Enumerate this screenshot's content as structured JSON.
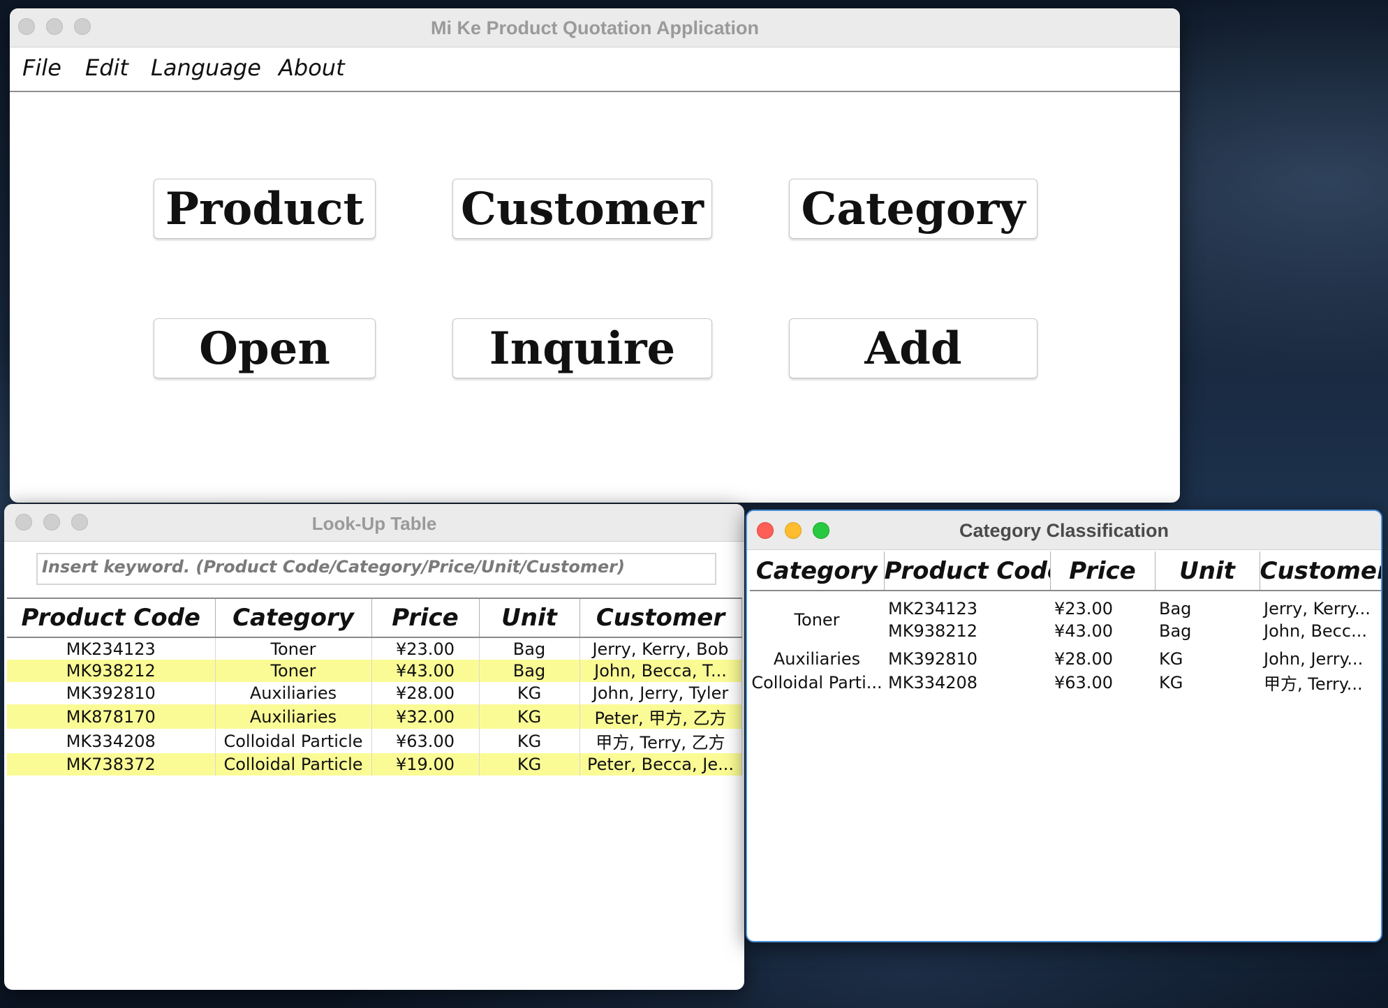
{
  "main": {
    "title": "Mi Ke Product Quotation Application",
    "menu": [
      "File",
      "Edit",
      "Language",
      "About"
    ],
    "buttons": [
      "Product",
      "Customer",
      "Category",
      "Open",
      "Inquire",
      "Add"
    ]
  },
  "lookup": {
    "title": "Look-Up Table",
    "search_placeholder": "Insert keyword. (Product Code/Category/Price/Unit/Customer)",
    "headers": [
      "Product Code",
      "Category",
      "Price",
      "Unit",
      "Customer"
    ],
    "rows": [
      [
        "MK234123",
        "Toner",
        "¥23.00",
        "Bag",
        "Jerry,  Kerry,  Bob"
      ],
      [
        "MK938212",
        "Toner",
        "¥43.00",
        "Bag",
        "John,   Becca,   T..."
      ],
      [
        "MK392810",
        "Auxiliaries",
        "¥28.00",
        "KG",
        "John,   Jerry,   Tyler"
      ],
      [
        "MK878170",
        "Auxiliaries",
        "¥32.00",
        "KG",
        "Peter, 甲方, 乙方"
      ],
      [
        "MK334208",
        "Colloidal Particle",
        "¥63.00",
        "KG",
        "甲方, Terry, 乙方"
      ],
      [
        "MK738372",
        "Colloidal Particle",
        "¥19.00",
        "KG",
        "Peter,  Becca,  Je..."
      ]
    ]
  },
  "category": {
    "title": "Category Classification",
    "headers": [
      "Category",
      "Product Code",
      "Price",
      "Unit",
      "Customer"
    ],
    "groups": [
      {
        "name": "Toner",
        "rows": [
          [
            "MK234123",
            "¥23.00",
            "Bag",
            "Jerry,  Kerry..."
          ],
          [
            "MK938212",
            "¥43.00",
            "Bag",
            "John,    Becc..."
          ]
        ]
      },
      {
        "name": "Auxiliaries",
        "rows": [
          [
            "MK392810",
            "¥28.00",
            "KG",
            "John,   Jerry..."
          ]
        ]
      },
      {
        "name": "Colloidal Parti...",
        "rows": [
          [
            "MK334208",
            "¥63.00",
            "KG",
            "甲方, Terry..."
          ]
        ]
      }
    ]
  }
}
